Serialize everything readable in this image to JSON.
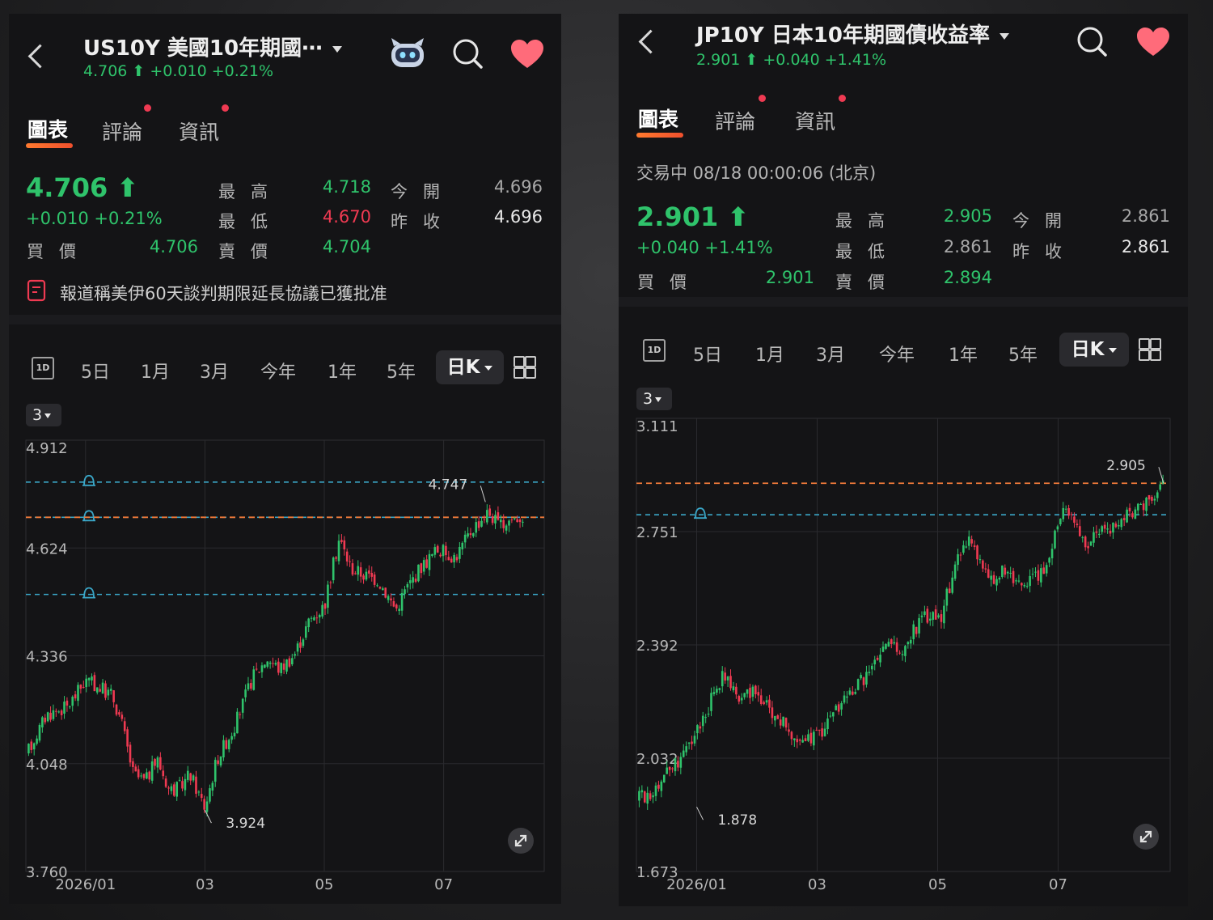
{
  "colors": {
    "up": "#2fc36b",
    "down": "#ef3a52",
    "alert_line": "#3aa7c8",
    "price_line": "#f07a3a",
    "heart": "#ff6b7a"
  },
  "left": {
    "header": {
      "title": "US10Y  美國10年期國⋯",
      "quote": "4.706 ⬆ +0.010 +0.21%"
    },
    "tabs": [
      {
        "label": "圖表"
      },
      {
        "label": "評論"
      },
      {
        "label": "資訊"
      }
    ],
    "quote": {
      "price": "4.706 ⬆",
      "change": "+0.010 +0.21%",
      "high_label": "最高",
      "high": "4.718",
      "open_label": "今開",
      "open": "4.696",
      "low_label": "最低",
      "low": "4.670",
      "prev_close_label": "昨收",
      "prev_close": "4.696",
      "bid_label": "買價",
      "bid": "4.706",
      "ask_label": "賣價",
      "ask": "4.704"
    },
    "news": "報道稱美伊60天談判期限延長協議已獲批准",
    "periods": [
      "5日",
      "1月",
      "3月",
      "今年",
      "1年",
      "5年"
    ],
    "interval_box": "1D",
    "kline_label": "日K",
    "indicator_chip": "3"
  },
  "right": {
    "header": {
      "title": "JP10Y  日本10年期國債收益率",
      "quote": "2.901 ⬆ +0.040 +1.41%"
    },
    "tabs": [
      {
        "label": "圖表"
      },
      {
        "label": "評論"
      },
      {
        "label": "資訊"
      }
    ],
    "status": "交易中   08/18 00:00:06 (北京)",
    "quote": {
      "price": "2.901 ⬆",
      "change": "+0.040 +1.41%",
      "high_label": "最高",
      "high": "2.905",
      "open_label": "今開",
      "open": "2.861",
      "low_label": "最低",
      "low": "2.861",
      "prev_close_label": "昨收",
      "prev_close": "2.861",
      "bid_label": "買價",
      "bid": "2.901",
      "ask_label": "賣價",
      "ask": "2.894"
    },
    "periods": [
      "5日",
      "1月",
      "3月",
      "今年",
      "1年",
      "5年"
    ],
    "interval_box": "1D",
    "kline_label": "日K",
    "indicator_chip": "3"
  },
  "chart_data": [
    {
      "type": "candlestick",
      "ylim": [
        3.76,
        4.912
      ],
      "y_ticks": [
        "4.912",
        "4.624",
        "4.336",
        "4.048",
        "3.760"
      ],
      "x_ticks": [
        "2026/01",
        "03",
        "05",
        "07"
      ],
      "x_tick_months": [
        1,
        3,
        5,
        7
      ],
      "annotations": [
        {
          "text": "4.747",
          "month": 7.7,
          "value": 4.747
        },
        {
          "text": "3.924",
          "month": 3.0,
          "value": 3.924
        }
      ],
      "current_price_line": 4.706,
      "alert_lines": [
        4.8,
        4.706,
        4.5
      ],
      "closes": [
        [
          0.0,
          4.07
        ],
        [
          0.35,
          4.18
        ],
        [
          0.7,
          4.2
        ],
        [
          1.0,
          4.27
        ],
        [
          1.25,
          4.25
        ],
        [
          1.45,
          4.23
        ],
        [
          1.6,
          4.16
        ],
        [
          1.8,
          4.02
        ],
        [
          2.0,
          4.0
        ],
        [
          2.2,
          4.06
        ],
        [
          2.4,
          3.98
        ],
        [
          2.55,
          3.98
        ],
        [
          2.75,
          4.02
        ],
        [
          3.0,
          3.93
        ],
        [
          3.2,
          4.06
        ],
        [
          3.5,
          4.15
        ],
        [
          3.8,
          4.28
        ],
        [
          4.05,
          4.33
        ],
        [
          4.25,
          4.3
        ],
        [
          4.5,
          4.34
        ],
        [
          4.75,
          4.43
        ],
        [
          5.0,
          4.47
        ],
        [
          5.25,
          4.65
        ],
        [
          5.45,
          4.57
        ],
        [
          5.7,
          4.55
        ],
        [
          5.9,
          4.54
        ],
        [
          6.2,
          4.46
        ],
        [
          6.35,
          4.51
        ],
        [
          6.6,
          4.57
        ],
        [
          6.9,
          4.62
        ],
        [
          7.2,
          4.6
        ],
        [
          7.5,
          4.68
        ],
        [
          7.75,
          4.72
        ],
        [
          7.95,
          4.68
        ],
        [
          8.1,
          4.7
        ],
        [
          8.35,
          4.71
        ]
      ]
    },
    {
      "type": "candlestick",
      "ylim": [
        1.673,
        3.111
      ],
      "y_ticks": [
        "3.111",
        "2.751",
        "2.392",
        "2.032",
        "1.673"
      ],
      "x_ticks": [
        "2026/01",
        "03",
        "05",
        "07"
      ],
      "x_tick_months": [
        1,
        3,
        5,
        7
      ],
      "annotations": [
        {
          "text": "2.905",
          "month": 8.75,
          "value": 2.905
        },
        {
          "text": "1.878",
          "month": 1.0,
          "value": 1.878
        }
      ],
      "current_price_line": 2.905,
      "alert_lines": [
        2.805
      ],
      "closes": [
        [
          0.0,
          1.9
        ],
        [
          0.25,
          1.93
        ],
        [
          0.55,
          2.0
        ],
        [
          0.85,
          2.06
        ],
        [
          1.2,
          2.2
        ],
        [
          1.45,
          2.3
        ],
        [
          1.65,
          2.22
        ],
        [
          1.9,
          2.25
        ],
        [
          2.25,
          2.18
        ],
        [
          2.55,
          2.12
        ],
        [
          2.75,
          2.08
        ],
        [
          3.0,
          2.1
        ],
        [
          3.2,
          2.16
        ],
        [
          3.45,
          2.22
        ],
        [
          3.7,
          2.27
        ],
        [
          3.95,
          2.33
        ],
        [
          4.2,
          2.4
        ],
        [
          4.4,
          2.36
        ],
        [
          4.6,
          2.44
        ],
        [
          4.85,
          2.49
        ],
        [
          5.05,
          2.47
        ],
        [
          5.25,
          2.62
        ],
        [
          5.45,
          2.73
        ],
        [
          5.65,
          2.68
        ],
        [
          5.85,
          2.6
        ],
        [
          6.1,
          2.63
        ],
        [
          6.3,
          2.58
        ],
        [
          6.5,
          2.6
        ],
        [
          6.75,
          2.63
        ],
        [
          6.95,
          2.75
        ],
        [
          7.1,
          2.85
        ],
        [
          7.25,
          2.79
        ],
        [
          7.45,
          2.71
        ],
        [
          7.65,
          2.74
        ],
        [
          7.85,
          2.76
        ],
        [
          8.1,
          2.8
        ],
        [
          8.35,
          2.82
        ],
        [
          8.55,
          2.85
        ],
        [
          8.75,
          2.9
        ]
      ]
    }
  ]
}
